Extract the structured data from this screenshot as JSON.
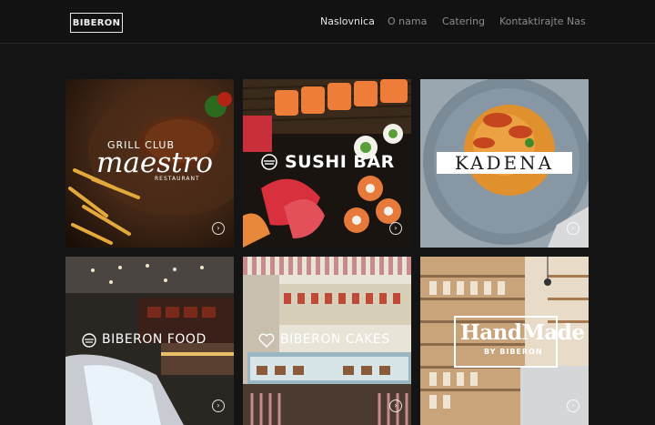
{
  "header": {
    "logo": "BIBERON",
    "nav": [
      "Naslovnica",
      "O nama",
      "Catering",
      "Kontaktirajte Nas"
    ]
  },
  "tiles": [
    {
      "line1": "GRILL CLUB",
      "line2": "maestro",
      "line3": "RESTAURANT"
    },
    {
      "name": "SUSHI BAR"
    },
    {
      "name": "KADENA"
    },
    {
      "name": "BIBERON FOOD"
    },
    {
      "name": "BIBERON CAKES"
    },
    {
      "line1": "HandMade",
      "line2": "BY BIBERON"
    }
  ],
  "icons": {
    "arrow": "chevron-right-icon",
    "bowl": "bowl-icon",
    "heart": "heart-icon"
  },
  "colors": {
    "background": "#141414",
    "header": "#121212",
    "nav_active": "#e6e6e6",
    "nav_inactive": "#8c8c8c"
  }
}
